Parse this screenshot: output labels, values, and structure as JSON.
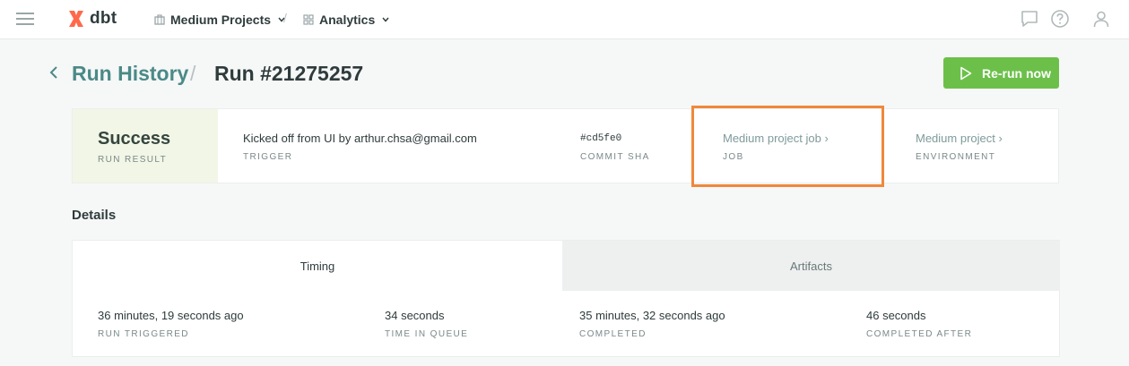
{
  "nav": {
    "brand": "dbt",
    "project": "Medium Projects",
    "section": "Analytics",
    "separator": "/",
    "icons": [
      "hamburger-icon",
      "dbt-logo-icon",
      "briefcase-icon",
      "grid-icon",
      "chat-icon",
      "help-icon",
      "user-icon"
    ]
  },
  "header": {
    "breadcrumb_parent": "Run History",
    "breadcrumb_separator": "/",
    "title": "Run #21275257",
    "rerun_label": "Re-run now"
  },
  "summary": {
    "run_result": {
      "value": "Success",
      "label": "RUN RESULT"
    },
    "trigger": {
      "value": "Kicked off from UI by arthur.chsa@gmail.com",
      "label": "TRIGGER"
    },
    "commit": {
      "value": "#cd5fe0",
      "label": "COMMIT SHA"
    },
    "job": {
      "value": "Medium project job ›",
      "label": "JOB"
    },
    "environment": {
      "value": "Medium project ›",
      "label": "ENVIRONMENT"
    }
  },
  "details": {
    "title": "Details",
    "tabs": {
      "timing": "Timing",
      "artifacts": "Artifacts"
    },
    "timing": [
      {
        "value": "36 minutes, 19 seconds ago",
        "label": "RUN TRIGGERED"
      },
      {
        "value": "34 seconds",
        "label": "TIME IN QUEUE"
      },
      {
        "value": "35 minutes, 32 seconds ago",
        "label": "COMPLETED"
      },
      {
        "value": "46 seconds",
        "label": "COMPLETED AFTER"
      }
    ]
  },
  "colors": {
    "accent_green": "#6cc04a",
    "brand_orange": "#ff694b",
    "link_teal": "#4a8a87",
    "highlight_orange": "#f0883a",
    "success_bg": "#f2f6e6"
  }
}
